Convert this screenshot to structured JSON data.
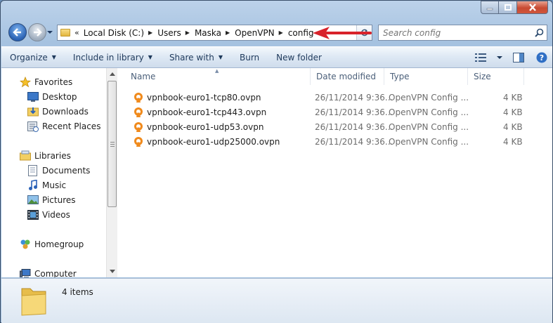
{
  "address": {
    "chevron": "«",
    "crumbs": [
      "Local Disk (C:)",
      "Users",
      "Maska",
      "OpenVPN",
      "config"
    ]
  },
  "search": {
    "placeholder": "Search config"
  },
  "toolbar": {
    "organize": "Organize",
    "include_in_library": "Include in library",
    "share_with": "Share with",
    "burn": "Burn",
    "new_folder": "New folder"
  },
  "nav": {
    "favorites": "Favorites",
    "desktop": "Desktop",
    "downloads": "Downloads",
    "recent_places": "Recent Places",
    "libraries": "Libraries",
    "documents": "Documents",
    "music": "Music",
    "pictures": "Pictures",
    "videos": "Videos",
    "homegroup": "Homegroup",
    "computer": "Computer"
  },
  "columns": {
    "name": "Name",
    "date_modified": "Date modified",
    "type": "Type",
    "size": "Size"
  },
  "files": [
    {
      "name": "vpnbook-euro1-tcp80.ovpn",
      "date": "26/11/2014 9:36...",
      "type": "OpenVPN Config ...",
      "size": "4 KB"
    },
    {
      "name": "vpnbook-euro1-tcp443.ovpn",
      "date": "26/11/2014 9:36...",
      "type": "OpenVPN Config ...",
      "size": "4 KB"
    },
    {
      "name": "vpnbook-euro1-udp53.ovpn",
      "date": "26/11/2014 9:36...",
      "type": "OpenVPN Config ...",
      "size": "4 KB"
    },
    {
      "name": "vpnbook-euro1-udp25000.ovpn",
      "date": "26/11/2014 9:36...",
      "type": "OpenVPN Config ...",
      "size": "4 KB"
    }
  ],
  "status": {
    "item_count": "4 items"
  },
  "colors": {
    "annotation_arrow": "#d8222a",
    "accent": "#1e395b"
  }
}
